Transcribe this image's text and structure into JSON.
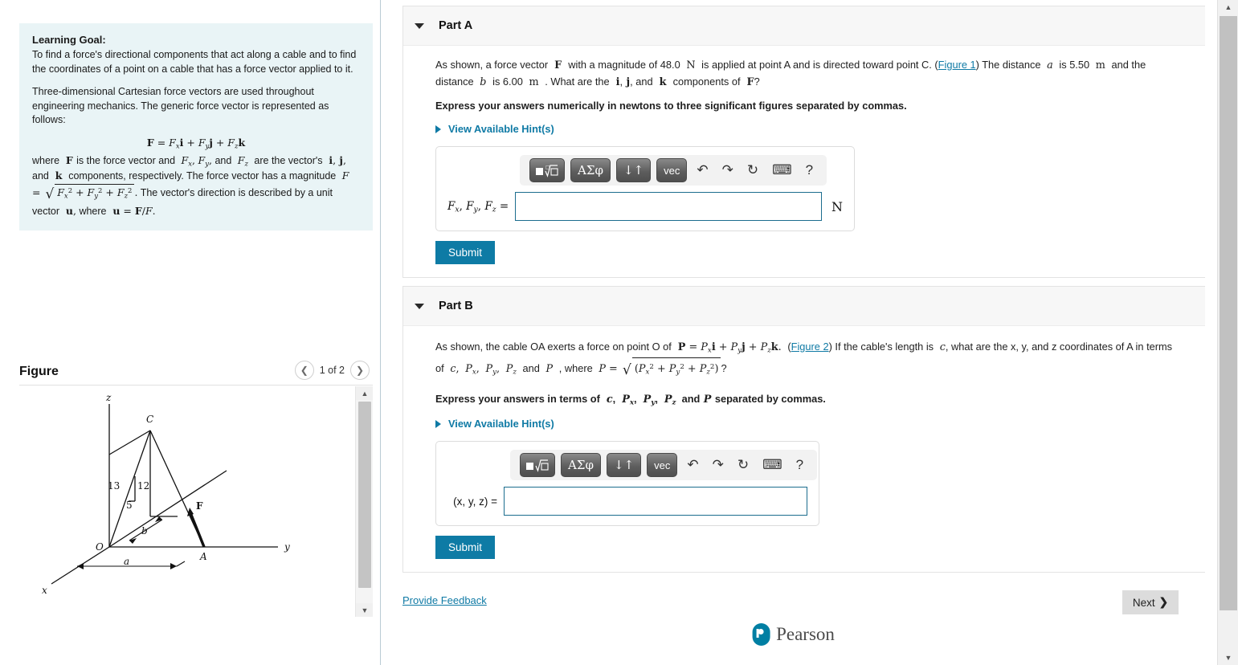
{
  "left": {
    "learning_goal": {
      "title": "Learning Goal:",
      "p1": "To find a force's directional components that act along a cable and to find the coordinates of a point on a cable that has a force vector applied to it.",
      "p2": "Three-dimensional Cartesian force vectors are used throughout engineering mechanics. The generic force vector is represented as follows:",
      "equation": "F = Fx i + Fy j + Fz k",
      "p3_a": "where",
      "p3_b": "is the force vector and",
      "p3_c": "and",
      "p3_d": "are the vector's",
      "p3_e": "and",
      "p3_f": "components, respectively. The force vector has a magnitude",
      "p3_g": "The vector's direction is described by a unit vector",
      "p3_h": "where"
    },
    "figure": {
      "title": "Figure",
      "count": "1 of 2",
      "prev_icon": "chevron-left-icon",
      "next_icon": "chevron-right-icon",
      "labels": {
        "z": "z",
        "x": "x",
        "y": "y",
        "O": "O",
        "A": "A",
        "C": "C",
        "F": "F",
        "a": "a",
        "b": "b",
        "n13": "13",
        "n12": "12",
        "n5": "5"
      }
    }
  },
  "parts": [
    {
      "id": "part-a",
      "label": "Part A",
      "collapse_icon": "triangle-down-icon",
      "question_prefix": "As shown, a force vector",
      "question_mid1": "with a magnitude of 48.0",
      "question_mid2": "is applied at point A and is directed toward point C.",
      "figure_link": "Figure 1",
      "question_mid3": "The distance",
      "question_mid4": "is 5.50",
      "question_mid5": "and the distance",
      "question_mid6": "is 6.00",
      "question_mid7": ". What are the",
      "question_mid8": "and",
      "question_mid9": "components of",
      "question_end": "?",
      "instruction": "Express your answers numerically in newtons to three significant figures separated by commas.",
      "hint_label": "View Available Hint(s)",
      "answer_label": "Fx , Fy , Fz =",
      "answer_value": "",
      "unit": "N",
      "submit_label": "Submit",
      "values": {
        "magnitude": "48.0",
        "magnitude_unit": "N",
        "a": "5.50",
        "b": "6.00",
        "length_unit": "m"
      }
    },
    {
      "id": "part-b",
      "label": "Part B",
      "collapse_icon": "triangle-down-icon",
      "question_prefix": "As shown, the cable OA exerts a force on point O of",
      "figure_link": "Figure 2",
      "question_mid1": "If the cable's length is",
      "question_mid2": ", what are the x, y, and z coordinates of A in terms of",
      "question_mid3": "and",
      "question_mid4": ", where",
      "question_end": "?",
      "instruction": "Express your answers in terms of c, Px, Py, Pz and P separated by commas.",
      "hint_label": "View Available Hint(s)",
      "answer_label": "(x, y, z) =",
      "answer_value": "",
      "submit_label": "Submit"
    }
  ],
  "toolbar": {
    "buttons": [
      {
        "name": "template-root-button",
        "glyph": "root"
      },
      {
        "name": "greek-symbols-button",
        "glyph": "ΑΣφ"
      },
      {
        "name": "sort-arrows-button",
        "glyph": "↓↑"
      },
      {
        "name": "vector-button",
        "glyph": "vec"
      }
    ],
    "icons": [
      {
        "name": "undo-icon",
        "glyph": "↰"
      },
      {
        "name": "redo-icon",
        "glyph": "↱"
      },
      {
        "name": "reset-icon",
        "glyph": "↻"
      },
      {
        "name": "keyboard-icon",
        "glyph": "⌨"
      },
      {
        "name": "help-icon",
        "glyph": "?"
      }
    ]
  },
  "footer": {
    "feedback_label": "Provide Feedback",
    "next_label": "Next",
    "next_chevron": "❯",
    "brand": "Pearson"
  },
  "colors": {
    "accent_teal": "#0e7ba5",
    "link": "#0f7aa5",
    "panel_bg": "#e9f4f6",
    "part_head_bg": "#f7f7f7",
    "next_bg": "#dcdcdc",
    "input_border": "#1c6d8e"
  }
}
